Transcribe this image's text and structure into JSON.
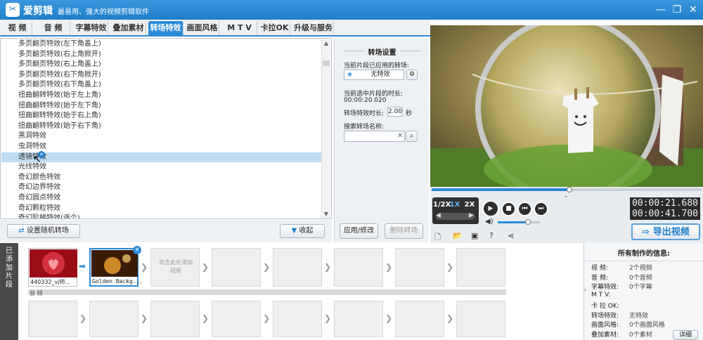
{
  "app": {
    "logo_glyph": "✂",
    "name": "爱剪辑",
    "slogan": "最易用、强大的视频剪辑软件"
  },
  "tabs": [
    {
      "label": "视 频"
    },
    {
      "label": "音 频"
    },
    {
      "label": "字幕特效"
    },
    {
      "label": "叠加素材"
    },
    {
      "label": "转场特效",
      "active": true
    },
    {
      "label": "画面风格"
    },
    {
      "label": "M T V"
    },
    {
      "label": "卡拉OK"
    },
    {
      "label": "升级与服务"
    }
  ],
  "transitions": [
    "多页翻页特效(左下角盖上)",
    "多页翻页特效(右上角掀开)",
    "多页翻页特效(右上角盖上)",
    "多页翻页特效(右下角掀开)",
    "多页翻页特效(右下角盖上)",
    "扭曲翻转特效(始于左上角)",
    "扭曲翻转特效(始于左下角)",
    "扭曲翻转特效(始于右上角)",
    "扭曲翻转特效(始于右下角)",
    "黑洞特效",
    "虫洞特效",
    "透镜特效",
    "光线特效",
    "奇幻颜色特效",
    "奇幻边界特效",
    "奇幻圆点特效",
    "奇幻颗粒特效",
    "奇幻阶梯特效(逐个)"
  ],
  "selected_transition_index": 11,
  "list_footer": {
    "random_label": "设置随机转场",
    "collapse_label": "收起"
  },
  "settings": {
    "title": "转场设置",
    "applied_label": "当前片段已应用的转场:",
    "applied_value": "无特效",
    "duration_label": "当前选中片段的时长:",
    "duration_value": "00:00:20.020",
    "effect_duration_label": "转场特效时长:",
    "effect_duration_value": "2.00",
    "effect_duration_unit": "秒",
    "search_label": "搜索转场名称:",
    "search_value": "",
    "apply_label": "应用/修改",
    "delete_label": "删除转场"
  },
  "player": {
    "speed_options": [
      "1/2X",
      "1X",
      "2X"
    ],
    "active_speed": "1X",
    "current_time": "00:00:21.680",
    "total_time": "00:00:41.700",
    "progress": 0.51,
    "volume": 0.72,
    "export_label": "导出视频"
  },
  "timeline": {
    "side_tab": "已添加片段",
    "clips": [
      {
        "name": "440332_vj师..."
      },
      {
        "name": "Golden Backg..."
      }
    ],
    "add_hint": "双击此处添加视频",
    "audio_label": "音 频"
  },
  "info": {
    "title": "所有制作的信息:",
    "rows": [
      {
        "k": "视 频:",
        "v": "2个视频"
      },
      {
        "k": "音 频:",
        "v": "0个音频"
      },
      {
        "k": "字幕特效:",
        "v": "0个字幕"
      },
      {
        "k": "M T V:",
        "v": ""
      },
      {
        "k": "卡 拉 OK:",
        "v": ""
      },
      {
        "k": "转场特效:",
        "v": "无特效"
      },
      {
        "k": "画面风格:",
        "v": "0个画面风格"
      },
      {
        "k": "叠加素材:",
        "v": "0个素材"
      }
    ],
    "detail_label": "详细"
  },
  "colors": {
    "accent": "#2b8bd6",
    "selection": "#bfdcf3"
  }
}
